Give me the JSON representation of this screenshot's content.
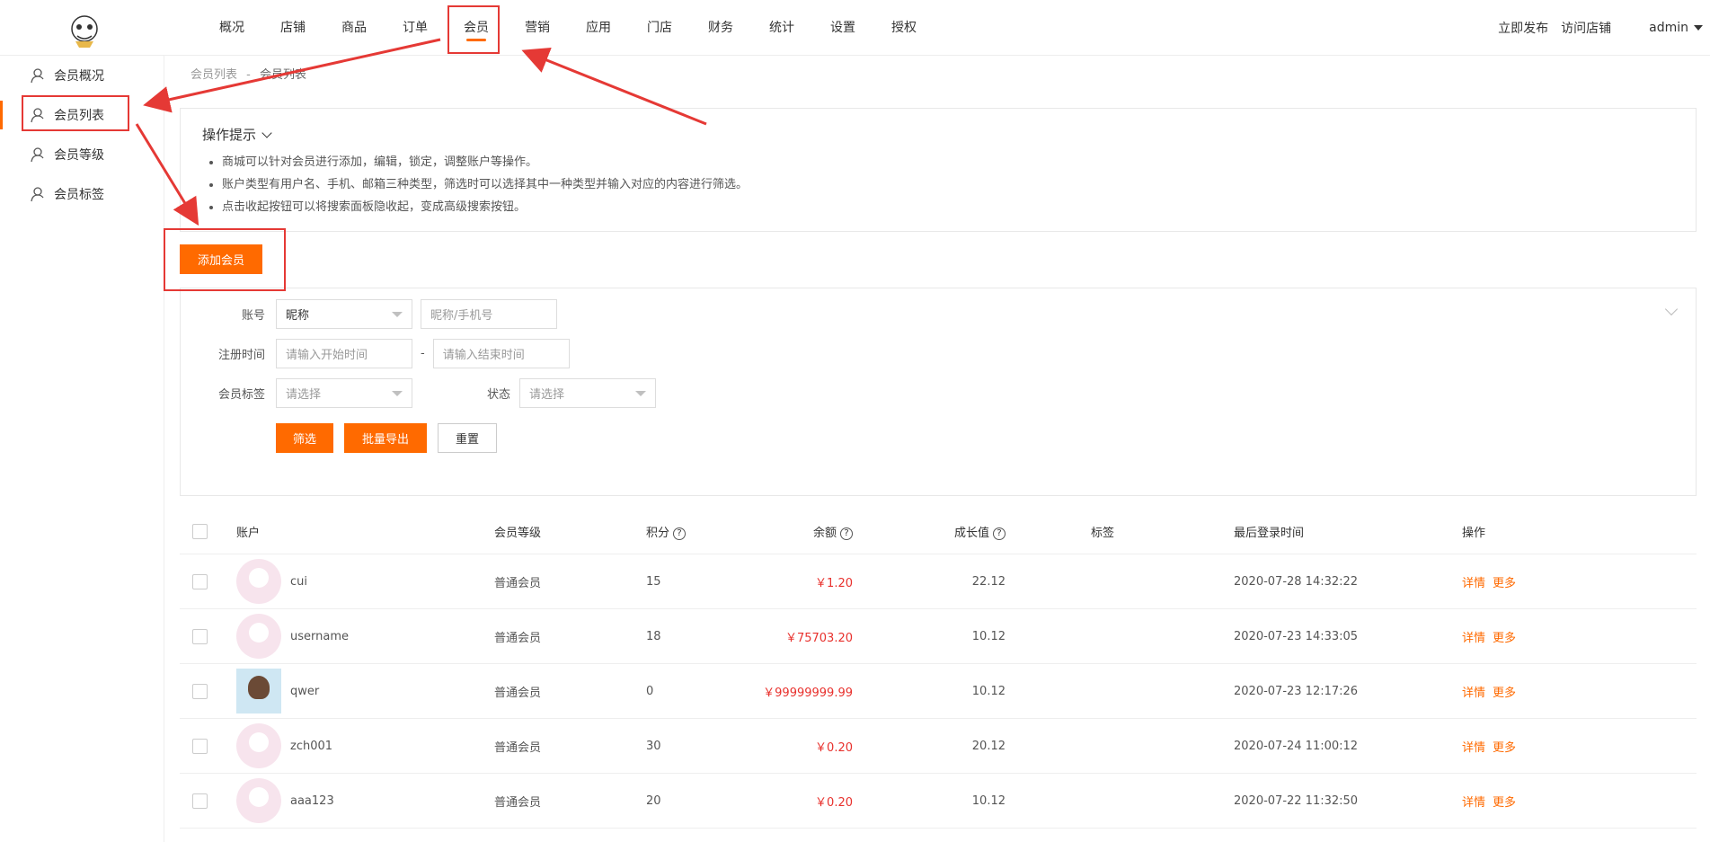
{
  "nav": {
    "items": [
      {
        "label": "概况"
      },
      {
        "label": "店铺"
      },
      {
        "label": "商品"
      },
      {
        "label": "订单"
      },
      {
        "label": "会员"
      },
      {
        "label": "营销"
      },
      {
        "label": "应用"
      },
      {
        "label": "门店"
      },
      {
        "label": "财务"
      },
      {
        "label": "统计"
      },
      {
        "label": "设置"
      },
      {
        "label": "授权"
      }
    ],
    "active_index": 4,
    "publish": "立即发布",
    "visit_store": "访问店铺",
    "user": "admin"
  },
  "sidebar": {
    "items": [
      {
        "label": "会员概况",
        "icon": "user-icon"
      },
      {
        "label": "会员列表",
        "icon": "user-list-icon"
      },
      {
        "label": "会员等级",
        "icon": "user-level-icon"
      },
      {
        "label": "会员标签",
        "icon": "user-tag-icon"
      }
    ],
    "active_index": 1
  },
  "breadcrumb": {
    "parent": "会员列表",
    "sep": "-",
    "current": "会员列表"
  },
  "tips": {
    "title": "操作提示",
    "lines": [
      "商城可以针对会员进行添加，编辑，锁定，调整账户等操作。",
      "账户类型有用户名、手机、邮箱三种类型，筛选时可以选择其中一种类型并输入对应的内容进行筛选。",
      "点击收起按钮可以将搜索面板隐收起，变成高级搜索按钮。"
    ]
  },
  "add_button": "添加会员",
  "filter": {
    "account_label": "账号",
    "account_type": "昵称",
    "account_placeholder": "昵称/手机号",
    "reg_label": "注册时间",
    "start_placeholder": "请输入开始时间",
    "dash": "-",
    "end_placeholder": "请输入结束时间",
    "tag_label": "会员标签",
    "tag_value": "请选择",
    "status_label": "状态",
    "status_value": "请选择",
    "filter_btn": "筛选",
    "export_btn": "批量导出",
    "reset_btn": "重置"
  },
  "table": {
    "headers": {
      "account": "账户",
      "level": "会员等级",
      "points": "积分",
      "balance": "余额",
      "growth": "成长值",
      "tags": "标签",
      "last_login": "最后登录时间",
      "actions": "操作",
      "help": "?"
    },
    "rows": [
      {
        "name": "cui",
        "level": "普通会员",
        "points": "15",
        "balance": "￥1.20",
        "growth": "22.12",
        "tags": "",
        "last_login": "2020-07-28 14:32:22",
        "detail": "详情",
        "more": "更多",
        "avatar": "default"
      },
      {
        "name": "username",
        "level": "普通会员",
        "points": "18",
        "balance": "￥75703.20",
        "growth": "10.12",
        "tags": "",
        "last_login": "2020-07-23 14:33:05",
        "detail": "详情",
        "more": "更多",
        "avatar": "default"
      },
      {
        "name": "qwer",
        "level": "普通会员",
        "points": "0",
        "balance": "￥99999999.99",
        "growth": "10.12",
        "tags": "",
        "last_login": "2020-07-23 12:17:26",
        "detail": "详情",
        "more": "更多",
        "avatar": "photo"
      },
      {
        "name": "zch001",
        "level": "普通会员",
        "points": "30",
        "balance": "￥0.20",
        "growth": "20.12",
        "tags": "",
        "last_login": "2020-07-24 11:00:12",
        "detail": "详情",
        "more": "更多",
        "avatar": "default"
      },
      {
        "name": "aaa123",
        "level": "普通会员",
        "points": "20",
        "balance": "￥0.20",
        "growth": "10.12",
        "tags": "",
        "last_login": "2020-07-22 11:32:50",
        "detail": "详情",
        "more": "更多",
        "avatar": "default"
      }
    ]
  },
  "colors": {
    "accent": "#ff6a00",
    "money": "#e8312d",
    "annotation": "#e53935"
  }
}
